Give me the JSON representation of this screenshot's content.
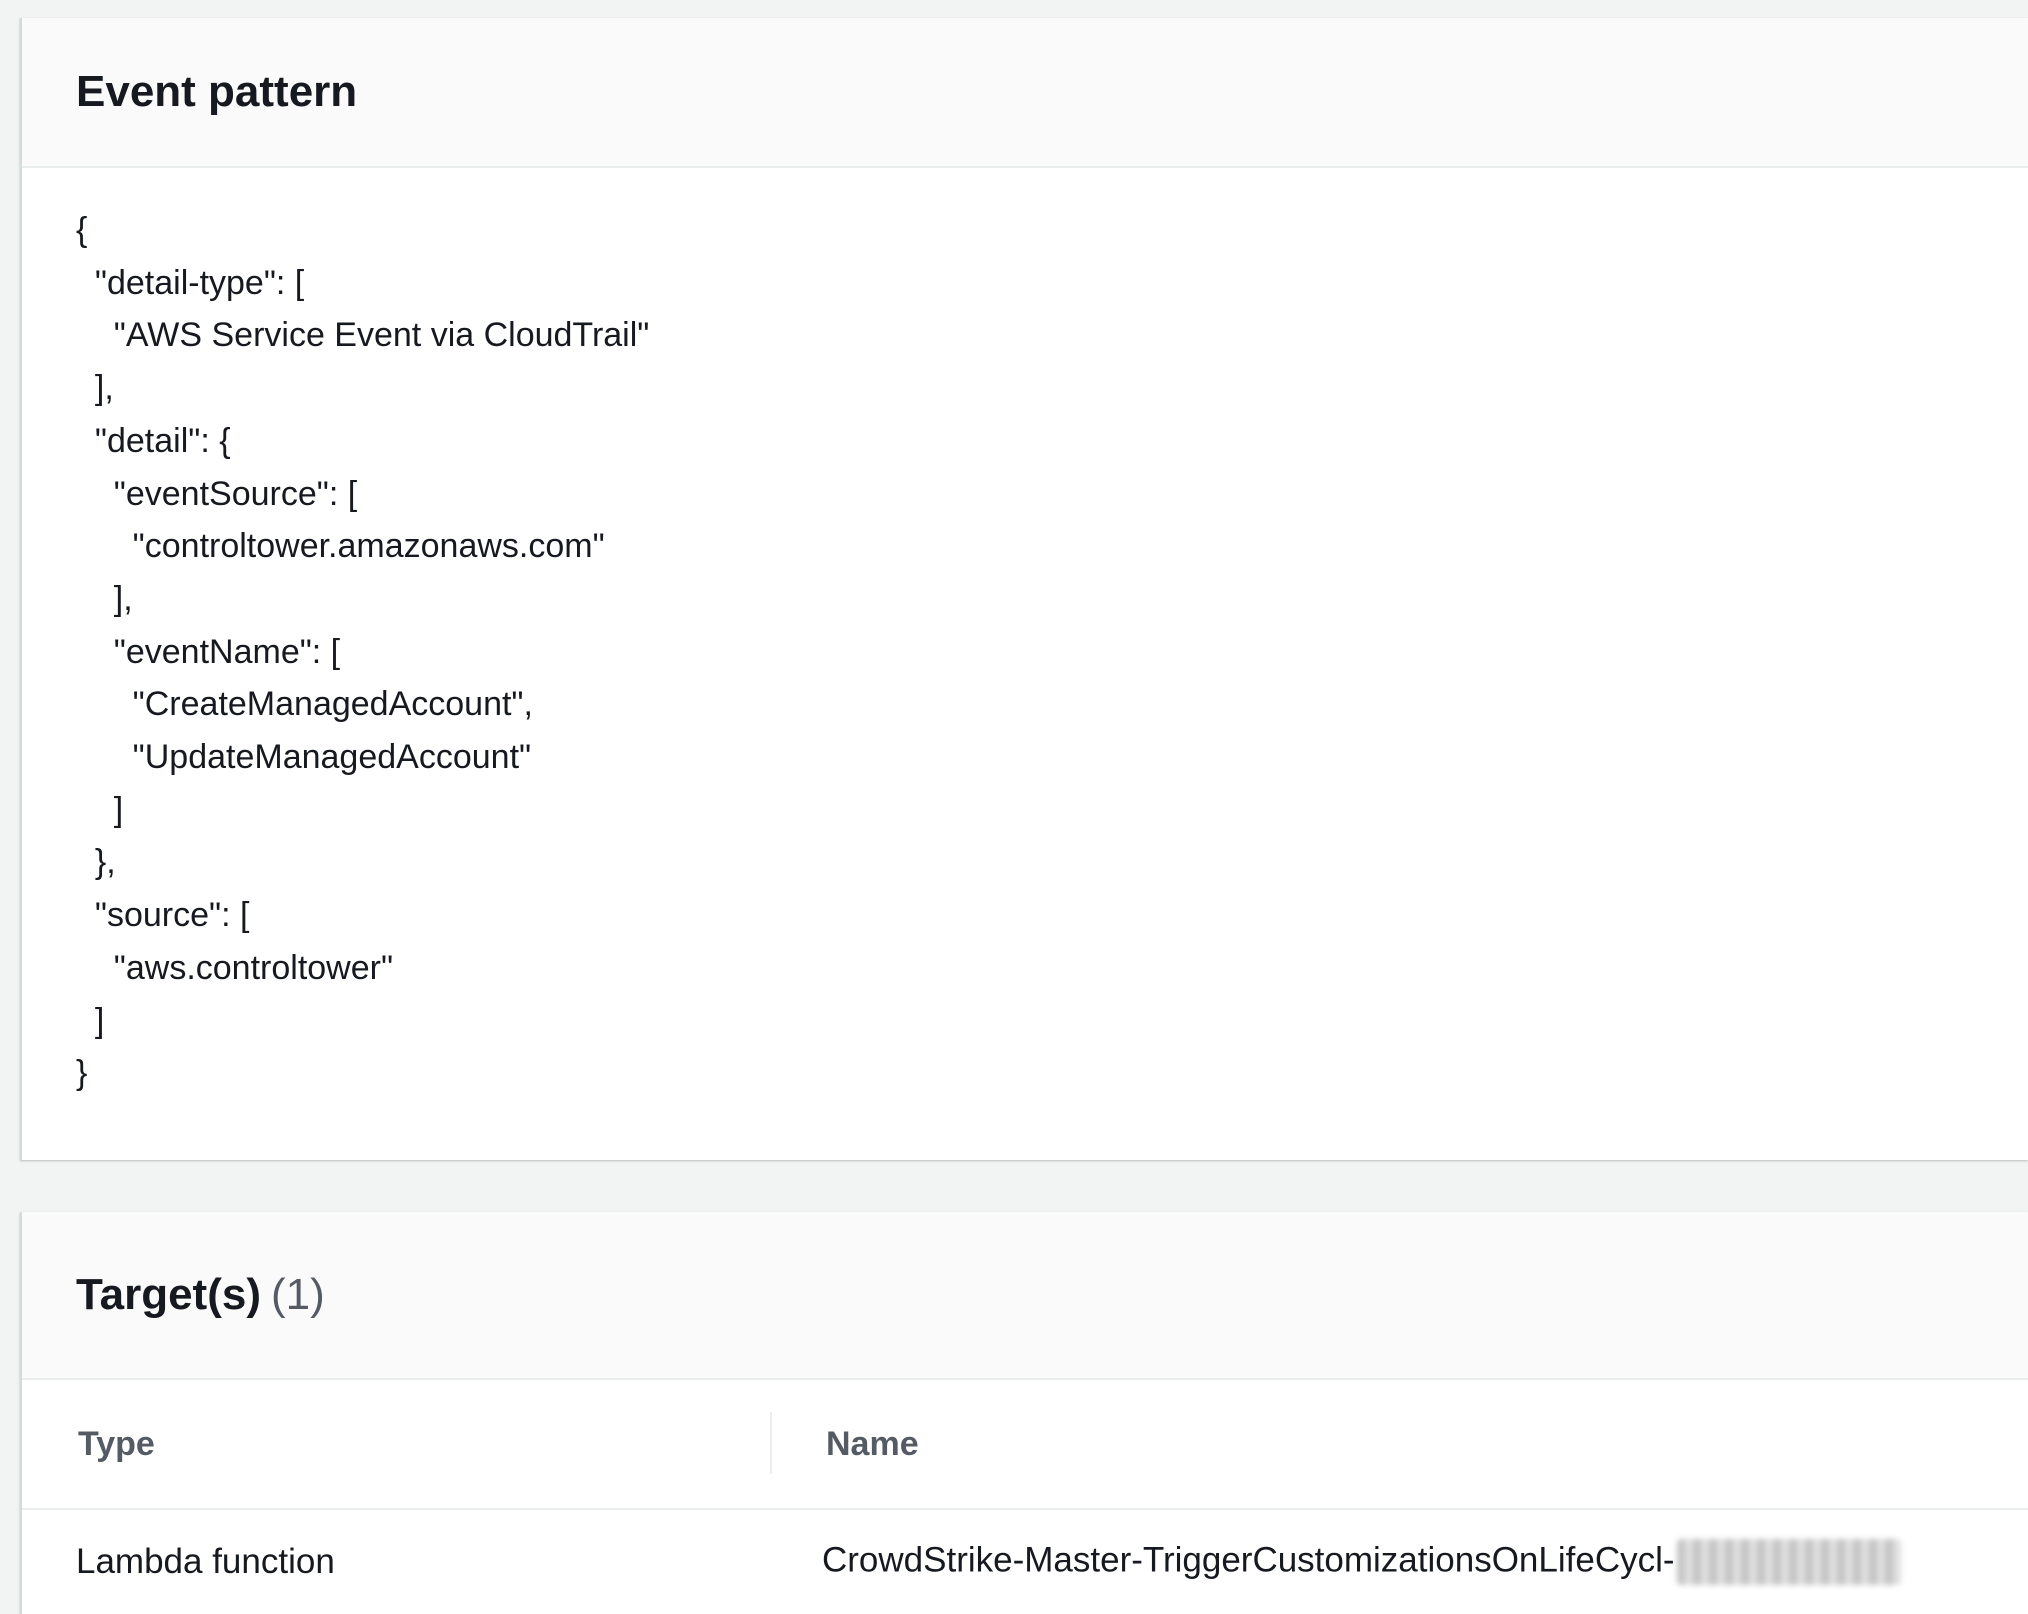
{
  "event_pattern": {
    "title": "Event pattern",
    "lines": [
      "{",
      "  \"detail-type\": [",
      "    \"AWS Service Event via CloudTrail\"",
      "  ],",
      "  \"detail\": {",
      "    \"eventSource\": [",
      "      \"controltower.amazonaws.com\"",
      "    ],",
      "    \"eventName\": [",
      "      \"CreateManagedAccount\",",
      "      \"UpdateManagedAccount\"",
      "    ]",
      "  },",
      "  \"source\": [",
      "    \"aws.controltower\"",
      "  ]",
      "}"
    ]
  },
  "targets": {
    "title": "Target(s)",
    "count": "(1)",
    "columns": {
      "type": "Type",
      "name": "Name"
    },
    "rows": [
      {
        "type": "Lambda function",
        "name": "CrowdStrike-Master-TriggerCustomizationsOnLifeCycl-"
      }
    ]
  }
}
